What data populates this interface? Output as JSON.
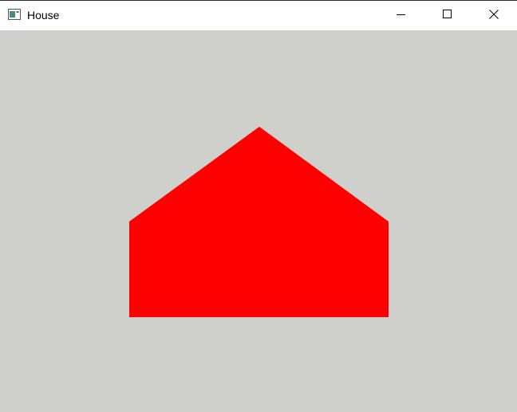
{
  "window": {
    "title": "House"
  },
  "icons": {
    "app": "app-window-icon",
    "minimize": "minimize-icon",
    "maximize": "maximize-icon",
    "close": "close-icon"
  },
  "colors": {
    "canvas_background": "#cfd0cb",
    "house_fill": "#ff0000"
  },
  "scene": {
    "shape": "house"
  }
}
